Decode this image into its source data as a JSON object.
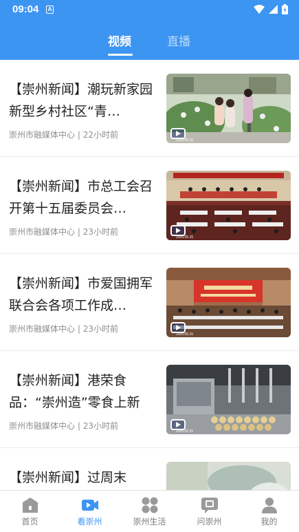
{
  "status_bar": {
    "time": "09:04",
    "notification_glyph": "A"
  },
  "tabs": [
    {
      "label": "视频",
      "active": true
    },
    {
      "label": "直播",
      "active": false
    }
  ],
  "items": [
    {
      "title": "【崇州新闻】潮玩新家园 新型乡村社区“青…",
      "source": "崇州市融媒体中心",
      "time": "22小时前",
      "thumb_date": "2025.05.15",
      "thumb_icon": "garden-photo"
    },
    {
      "title": "【崇州新闻】市总工会召开第十五届委员会…",
      "source": "崇州市融媒体中心",
      "time": "23小时前",
      "thumb_date": "2025.05.15",
      "thumb_icon": "conference-hall-photo"
    },
    {
      "title": "【崇州新闻】市爱国拥军联合会各项工作成…",
      "source": "崇州市融媒体中心",
      "time": "23小时前",
      "thumb_date": "2025.05.15",
      "thumb_icon": "meeting-room-photo"
    },
    {
      "title": "【崇州新闻】港荣食品：“崇州造”零食上新",
      "source": "崇州市融媒体中心",
      "time": "23小时前",
      "thumb_date": "2025.05.15",
      "thumb_icon": "factory-line-photo"
    },
    {
      "title": "【崇州新闻】过周末",
      "source": "",
      "time": "",
      "thumb_date": "",
      "thumb_icon": "outdoor-photo"
    }
  ],
  "bottom_nav": [
    {
      "label": "首页",
      "icon": "home-icon",
      "active": false
    },
    {
      "label": "看崇州",
      "icon": "video-camera-icon",
      "active": true
    },
    {
      "label": "崇州生活",
      "icon": "grid-apps-icon",
      "active": false
    },
    {
      "label": "问崇州",
      "icon": "question-chat-icon",
      "active": false
    },
    {
      "label": "我的",
      "icon": "profile-icon",
      "active": false
    }
  ],
  "colors": {
    "accent": "#3d95f2",
    "text": "#222222",
    "meta": "#8e8e8e",
    "nav_inactive": "#7d7d7d"
  }
}
